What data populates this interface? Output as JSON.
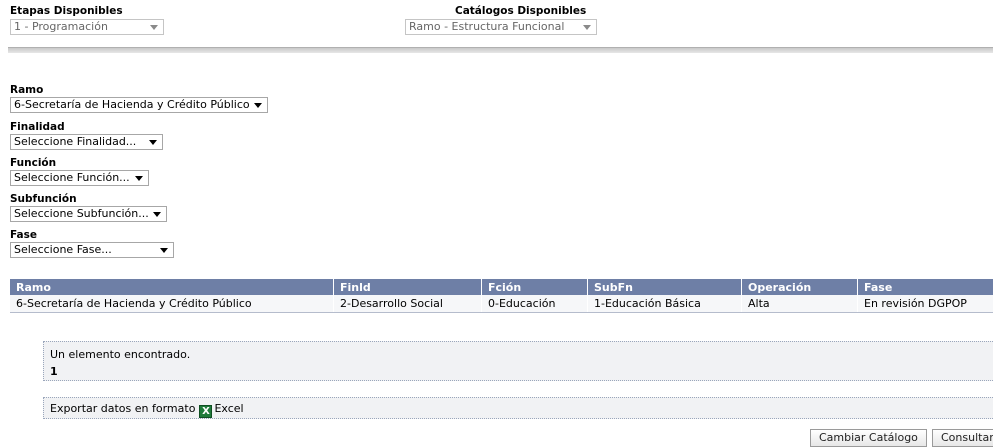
{
  "top": {
    "etapas_label": "Etapas Disponibles",
    "etapas_value": "1 - Programación",
    "catalogos_label": "Catálogos Disponibles",
    "catalogos_value": "Ramo - Estructura Funcional"
  },
  "filters": {
    "ramo_label": "Ramo",
    "ramo_value": "6-Secretaría de Hacienda y Crédito Público",
    "finalidad_label": "Finalidad",
    "finalidad_value": "Seleccione Finalidad...",
    "funcion_label": "Función",
    "funcion_value": "Seleccione Función...",
    "subfuncion_label": "Subfunción",
    "subfuncion_value": "Seleccione Subfunción...",
    "fase_label": "Fase",
    "fase_value": "Seleccione Fase..."
  },
  "table": {
    "headers": [
      "Ramo",
      "Finld",
      "Fción",
      "SubFn",
      "Operación",
      "Fase"
    ],
    "rows": [
      [
        "6-Secretaría de Hacienda y Crédito Público",
        "2-Desarrollo Social",
        "0-Educación",
        "1-Educación Básica",
        "Alta",
        "En revisión DGPOP"
      ]
    ]
  },
  "results": {
    "message": "Un elemento encontrado.",
    "page": "1"
  },
  "export": {
    "text": "Exportar datos en formato",
    "icon": "excel-icon",
    "link": "Excel"
  },
  "buttons": {
    "cambiar": "Cambiar Catálogo",
    "consultar": "Consultar"
  },
  "colors": {
    "header_bg": "#6e7fa6",
    "row_bg": "#f6f7f9"
  }
}
